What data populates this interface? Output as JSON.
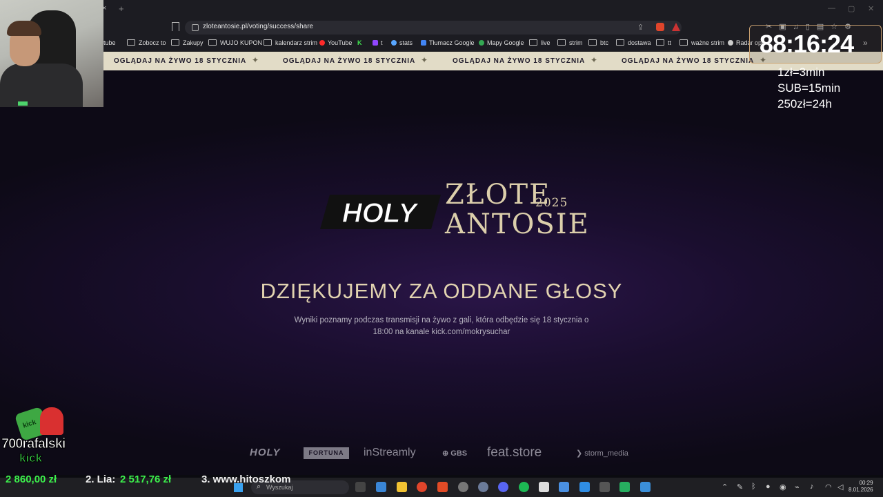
{
  "browser": {
    "url": "zloteantosie.pl/voting/success/share",
    "tab_close": "×",
    "tab_new": "+",
    "window_controls": [
      "—",
      "▢",
      "✕"
    ]
  },
  "bookmarks": [
    {
      "label": "outube",
      "type": "folder"
    },
    {
      "label": "Zobocz to",
      "type": "folder"
    },
    {
      "label": "Zakupy",
      "type": "folder"
    },
    {
      "label": "WUJO KUPON",
      "type": "folder"
    },
    {
      "label": "kalendarz strim",
      "type": "folder"
    },
    {
      "label": "YouTube",
      "type": "site",
      "color": "#ff2a2a"
    },
    {
      "label": "K",
      "type": "site",
      "color": "#3fe04f"
    },
    {
      "label": "t",
      "type": "site",
      "color": "#9146ff"
    },
    {
      "label": "stats",
      "type": "site",
      "color": "#58a6ff"
    },
    {
      "label": "Tłumacz Google",
      "type": "site",
      "color": "#4285f4"
    },
    {
      "label": "Mapy Google",
      "type": "site",
      "color": "#34a853"
    },
    {
      "label": "live",
      "type": "folder"
    },
    {
      "label": "strim",
      "type": "folder"
    },
    {
      "label": "btc",
      "type": "folder"
    },
    {
      "label": "dostawa",
      "type": "folder"
    },
    {
      "label": "tt",
      "type": "folder"
    },
    {
      "label": "ważne strim",
      "type": "folder"
    },
    {
      "label": "Radar opa",
      "type": "site",
      "color": "#cccccc"
    }
  ],
  "ticker": {
    "text": "OGLĄDAJ NA ŻYWO 18 STYCZNIA",
    "separator": "✦"
  },
  "hero": {
    "logo_holy": "HOLY",
    "title_line1": "ZŁOTE",
    "year": "2025",
    "title_line2": "ANTOSIE",
    "headline": "DZIĘKUJEMY ZA ODDANE GŁOSY",
    "subtext": "Wyniki poznamy podczas transmisji na żywo z gali, która odbędzie się 18 stycznia o 18:00 na kanale kick.com/mokrysuchar"
  },
  "sponsors": {
    "holy": "HOLY",
    "fortuna": "FORTUNA",
    "instreamly": "inStreamly",
    "gbs": "GBS",
    "feat": "feat.store",
    "storm": "storm_media"
  },
  "overlay": {
    "timer": "88:16:24",
    "rule1": "1zł=3min",
    "rule2": "SUB=15min",
    "rule3": "250zł=24h",
    "kick_name": "700rafalski",
    "kick_word": "kick",
    "kick_badge": "kick",
    "leaderboard": {
      "amount1": "2 860,00 zł",
      "entry2_label": "2. Lia:",
      "amount2": "2 517,76 zł",
      "entry3": "3. www.hitoszkom"
    }
  },
  "taskbar": {
    "search_placeholder": "Wyszukaj",
    "time": "00:29",
    "date": "8.01.2026"
  },
  "colors": {
    "gold": "#dccfab",
    "ticker_bg": "#e2dcc7",
    "page_bg": "#1a0e2e",
    "kick_green": "#3fe04f"
  }
}
